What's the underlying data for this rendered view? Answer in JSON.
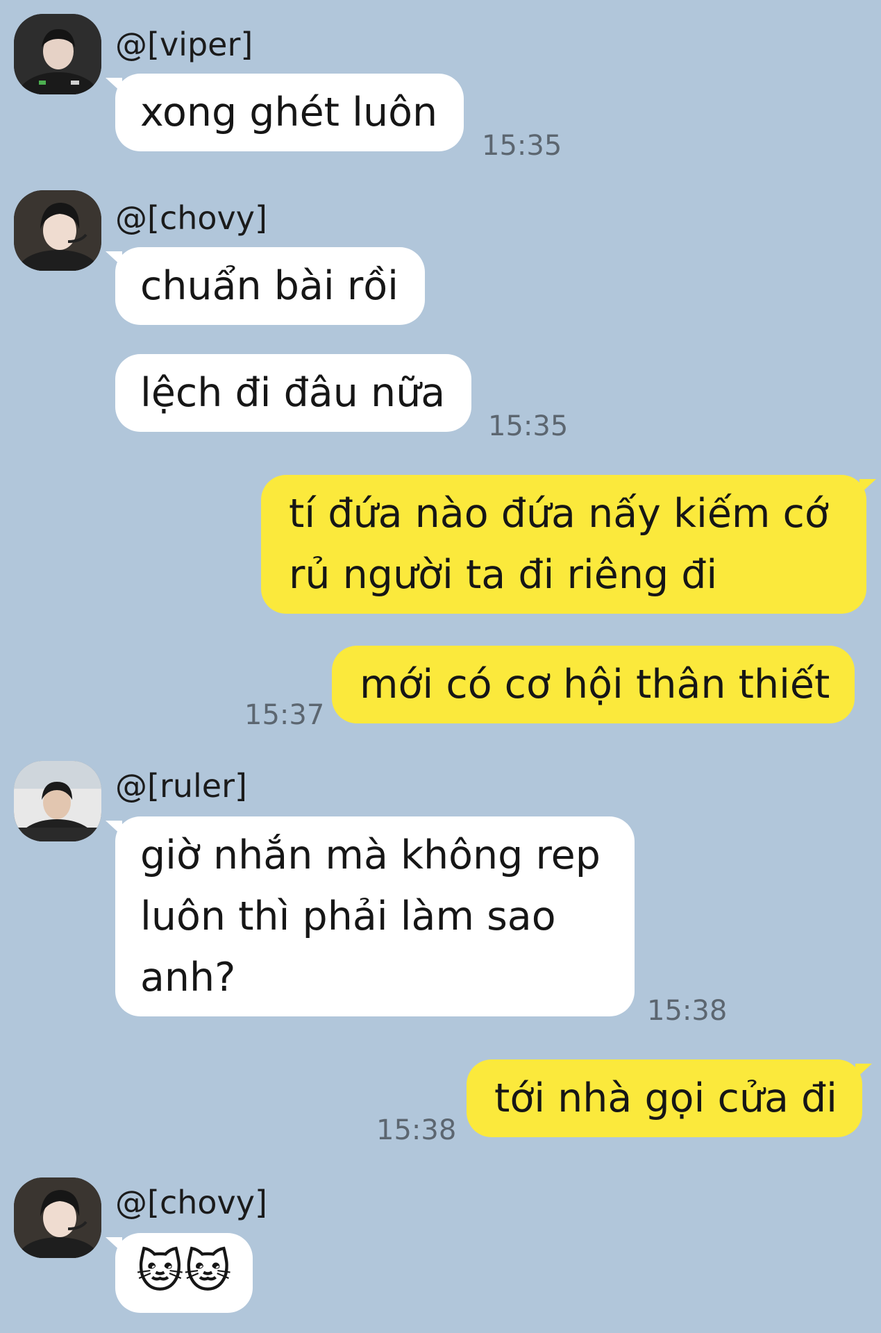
{
  "chat": {
    "messages": [
      {
        "sender": "@[viper]",
        "text": "xong ghét luôn",
        "time": "15:35"
      },
      {
        "sender": "@[chovy]",
        "texts": [
          "chuẩn bài rồi",
          "lệch đi đâu nữa"
        ],
        "time": "15:35"
      },
      {
        "sender": "me",
        "texts": [
          "tí đứa nào đứa nấy kiếm cớ rủ người ta đi riêng đi",
          "mới có cơ hội thân thiết"
        ],
        "time": "15:37"
      },
      {
        "sender": "@[ruler]",
        "text": "giờ nhắn mà không rep luôn thì phải làm sao anh?",
        "time": "15:38"
      },
      {
        "sender": "me",
        "text": "tới nhà gọi cửa đi",
        "time": "15:38"
      },
      {
        "sender": "@[chovy]",
        "text": "🐱🐱"
      }
    ]
  },
  "colors": {
    "background": "#b1c6da",
    "incoming_bubble": "#ffffff",
    "outgoing_bubble": "#fbe93c"
  }
}
